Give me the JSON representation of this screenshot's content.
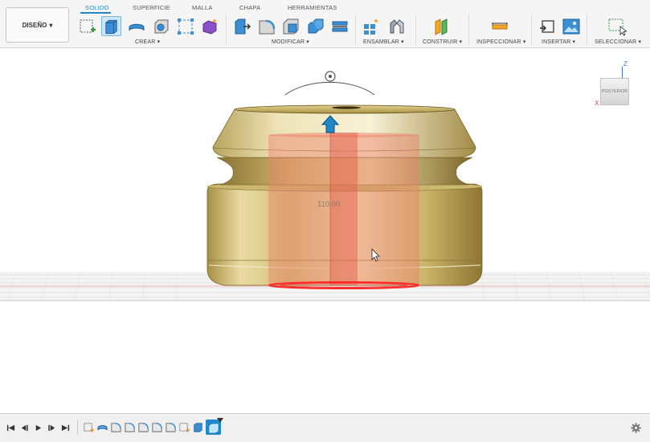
{
  "workspace": {
    "label": "DISEÑO",
    "caret": "▾"
  },
  "tabs": [
    {
      "label": "SOLIDO",
      "active": true
    },
    {
      "label": "SUPERFICIE",
      "active": false
    },
    {
      "label": "MALLA",
      "active": false
    },
    {
      "label": "CHAPA",
      "active": false
    },
    {
      "label": "HERRAMIENTAS",
      "active": false
    }
  ],
  "groups": {
    "crear": "CREAR ▾",
    "modificar": "MODIFICAR ▾",
    "ensamblar": "ENSAMBLAR ▾",
    "construir": "CONSTRUIR ▾",
    "inspeccionar": "INSPECCIONAR ▾",
    "insertar": "INSERTAR ▾",
    "seleccionar": "SELECCIONAR ▾"
  },
  "viewport": {
    "dimension_value": "110.00",
    "viewcube_face": "POSTERIOR",
    "axis_z": "Z",
    "axis_x": "X"
  },
  "colors": {
    "accent": "#1e88c8",
    "gold": "#c9b26a",
    "extrude_preview": "#e8705a"
  }
}
